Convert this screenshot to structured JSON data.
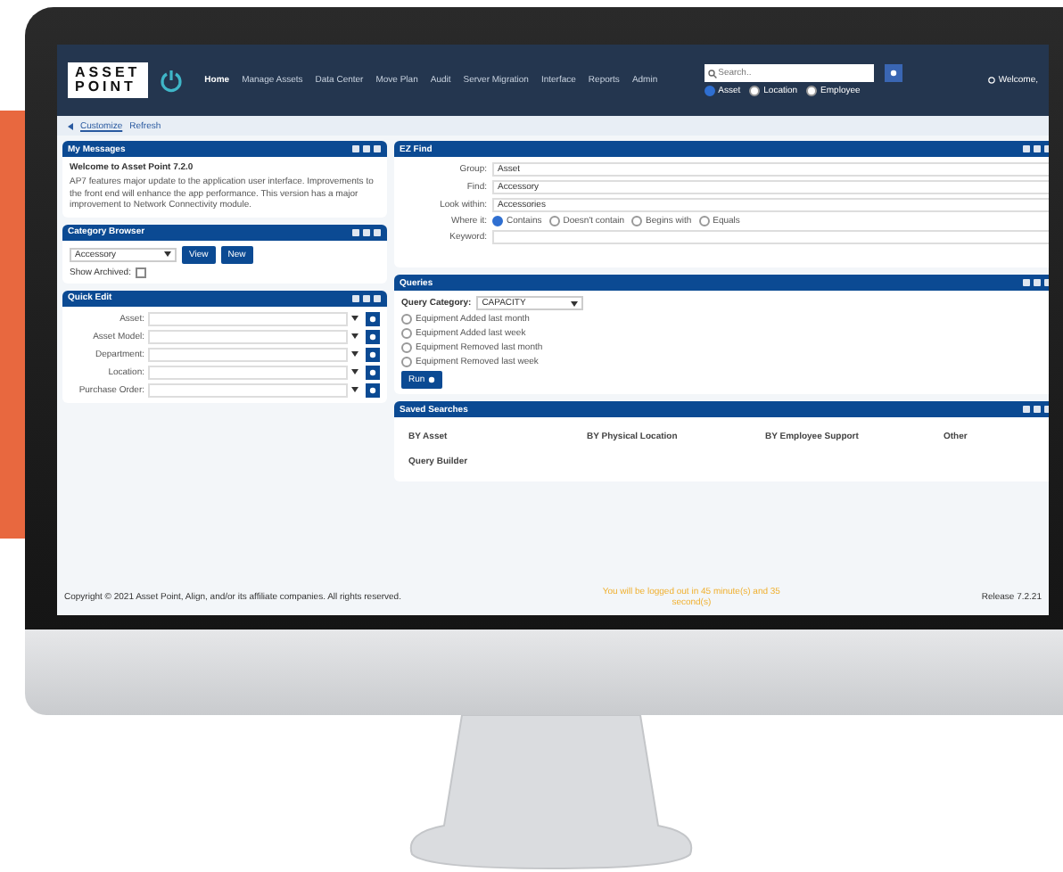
{
  "header": {
    "logo": [
      "ASSET",
      "POINT"
    ],
    "nav": [
      {
        "label": "Home",
        "selected": true
      },
      {
        "label": "Manage Assets",
        "selected": false
      },
      {
        "label": "Data Center",
        "selected": false
      },
      {
        "label": "Move Plan",
        "selected": false
      },
      {
        "label": "Audit",
        "selected": false
      },
      {
        "label": "Server Migration",
        "selected": false
      },
      {
        "label": "Interface",
        "selected": false
      },
      {
        "label": "Reports",
        "selected": false
      },
      {
        "label": "Admin",
        "selected": false
      }
    ],
    "search": {
      "placeholder": "Search..",
      "scopes": [
        {
          "label": "Asset",
          "selected": true
        },
        {
          "label": "Location",
          "selected": false
        },
        {
          "label": "Employee",
          "selected": false
        }
      ]
    },
    "welcome": "Welcome,"
  },
  "breadcrumb": {
    "links": [
      "Customize",
      "Refresh"
    ]
  },
  "my_messages": {
    "title": "My Messages",
    "heading": "Welcome to Asset Point 7.2.0",
    "body": "AP7 features major update to the application user interface. Improvements to the front end will enhance the app performance. This version has a major improvement to Network Connectivity module."
  },
  "category_browser": {
    "title": "Category Browser",
    "category": "Accessory",
    "buttons": [
      "View",
      "New"
    ],
    "archived_label": "Show Archived:",
    "archived_checked": false
  },
  "quick_edit": {
    "title": "Quick Edit",
    "fields": [
      "Asset:",
      "Asset Model:",
      "Department:",
      "Location:",
      "Purchase Order:"
    ]
  },
  "ez_find": {
    "title": "EZ Find",
    "fields": [
      {
        "label": "Group:",
        "value": "Asset"
      },
      {
        "label": "Find:",
        "value": "Accessory"
      },
      {
        "label": "Look within:",
        "value": "Accessories"
      }
    ],
    "where_label": "Where it:",
    "where_options": [
      {
        "label": "Contains",
        "selected": true
      },
      {
        "label": "Doesn't contain",
        "selected": false
      },
      {
        "label": "Begins with",
        "selected": false
      },
      {
        "label": "Equals",
        "selected": false
      }
    ],
    "keyword_label": "Keyword:"
  },
  "queries": {
    "title": "Queries",
    "category_label": "Query Category:",
    "category": "CAPACITY",
    "options": [
      {
        "label": "Equipment Added last month",
        "selected": false
      },
      {
        "label": "Equipment Added last week",
        "selected": false
      },
      {
        "label": "Equipment Removed last month",
        "selected": false
      },
      {
        "label": "Equipment Removed last week",
        "selected": false
      }
    ],
    "run": "Run"
  },
  "saved_searches": {
    "title": "Saved Searches",
    "links": [
      "BY Asset",
      "BY Physical Location",
      "BY Employee Support",
      "Other",
      "Query Builder"
    ]
  },
  "footer": {
    "copyright": "Copyright © 2021 Asset Point, Align, and/or its affiliate companies. All rights reserved.",
    "logout": "You will be logged out in 45 minute(s) and 35 second(s)",
    "release": "Release 7.2.21"
  }
}
